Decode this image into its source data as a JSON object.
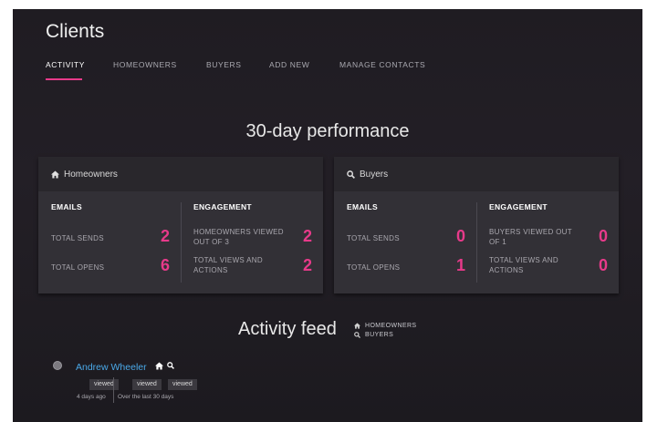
{
  "page": {
    "title": "Clients"
  },
  "tabs": [
    {
      "label": "ACTIVITY",
      "active": true
    },
    {
      "label": "HOMEOWNERS"
    },
    {
      "label": "BUYERS"
    },
    {
      "label": "ADD NEW"
    },
    {
      "label": "MANAGE CONTACTS"
    }
  ],
  "performance": {
    "title": "30-day performance",
    "cards": [
      {
        "title": "Homeowners",
        "icon": "home-icon",
        "emails_heading": "EMAILS",
        "engagement_heading": "ENGAGEMENT",
        "emails": [
          {
            "label": "TOTAL SENDS",
            "value": "2"
          },
          {
            "label": "TOTAL OPENS",
            "value": "6"
          }
        ],
        "engagement": [
          {
            "label": "HOMEOWNERS VIEWED OUT OF 3",
            "value": "2"
          },
          {
            "label": "TOTAL VIEWS AND ACTIONS",
            "value": "2"
          }
        ]
      },
      {
        "title": "Buyers",
        "icon": "search-icon",
        "emails_heading": "EMAILS",
        "engagement_heading": "ENGAGEMENT",
        "emails": [
          {
            "label": "TOTAL SENDS",
            "value": "0"
          },
          {
            "label": "TOTAL OPENS",
            "value": "1"
          }
        ],
        "engagement": [
          {
            "label": "BUYERS VIEWED OUT OF 1",
            "value": "0"
          },
          {
            "label": "TOTAL VIEWS AND ACTIONS",
            "value": "0"
          }
        ]
      }
    ]
  },
  "feed": {
    "title": "Activity feed",
    "legend": [
      {
        "icon": "home-icon",
        "label": "HOMEOWNERS"
      },
      {
        "icon": "search-icon",
        "label": "BUYERS"
      }
    ],
    "items": [
      {
        "name": "Andrew Wheeler",
        "badges": [
          "viewed",
          "viewed",
          "viewed"
        ],
        "time": "4 days ago",
        "period": "Over the last 30 days"
      }
    ]
  },
  "colors": {
    "accent": "#e73a8a",
    "link": "#4aa8e8",
    "background": "#201d23",
    "card": "#323036"
  }
}
